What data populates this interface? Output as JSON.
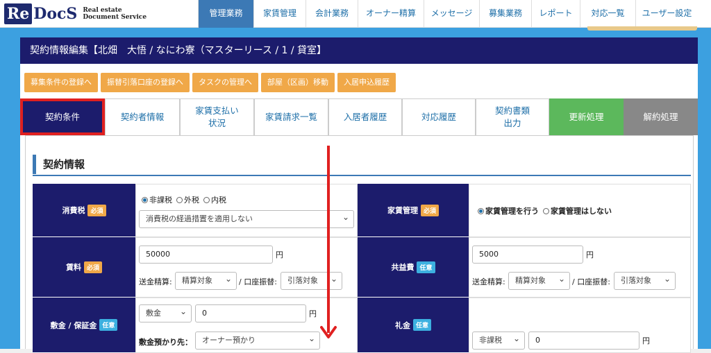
{
  "logo": {
    "re": "Re",
    "docs": "DocS",
    "sub1": "Real estate",
    "sub2": "Document Service"
  },
  "nav": [
    "管理業務",
    "家賃管理",
    "会計業務",
    "オーナー精算",
    "メッセージ",
    "募集業務",
    "レポート",
    "対応一覧",
    "ユーザー設定"
  ],
  "panel_title": "契約情報編集【北畑　大悟 / なにわ寮（マスターリース / 1 / 貸室】",
  "actions": [
    "募集条件の登録へ",
    "振替引落口座の登録へ",
    "タスクの管理へ",
    "部屋（区画）移動",
    "入居申込履歴"
  ],
  "tabs": [
    "契約条件",
    "契約者情報",
    "家賃支払い\n状況",
    "家賃請求一覧",
    "入居者履歴",
    "対応履歴",
    "契約書類\n出力",
    "更新処理",
    "解約処理"
  ],
  "section_title": "契約情報",
  "badges": {
    "required": "必須",
    "optional": "任意"
  },
  "consumption_tax": {
    "label": "消費税",
    "options": [
      "非課税",
      "外税",
      "内税"
    ],
    "selected": "非課税",
    "select_value": "消費税の経過措置を適用しない"
  },
  "rent_mgmt": {
    "label": "家賃管理",
    "options": [
      "家賃管理を行う",
      "家賃管理はしない"
    ],
    "selected": "家賃管理を行う"
  },
  "rent": {
    "label": "賃料",
    "value": "50000",
    "unit": "円",
    "send_label": "送金精算:",
    "send_value": "精算対象",
    "account_label": "/ 口座振替:",
    "account_value": "引落対象"
  },
  "common_fee": {
    "label": "共益費",
    "value": "5000",
    "unit": "円",
    "send_label": "送金精算:",
    "send_value": "精算対象",
    "account_label": "/ 口座振替:",
    "account_value": "引落対象"
  },
  "deposit": {
    "label": "敷金 / 保証金",
    "type_value": "敷金",
    "value": "0",
    "unit": "円",
    "holder_label": "敷金預かり先：",
    "holder_value": "オーナー預かり"
  },
  "key_money": {
    "label": "礼金",
    "tax_value": "非課税",
    "value": "0",
    "unit": "円"
  }
}
